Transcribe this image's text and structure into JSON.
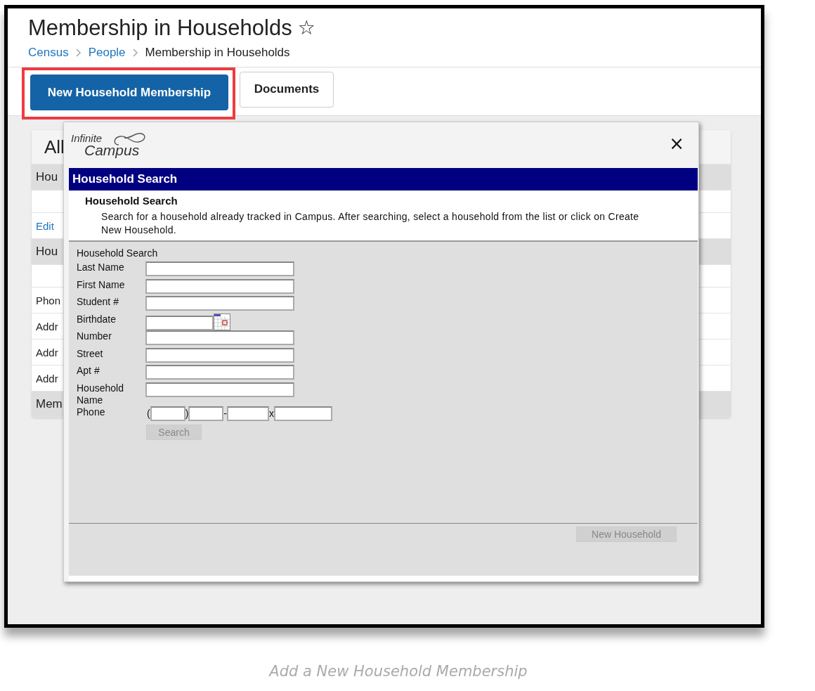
{
  "page": {
    "title": "Membership in Households",
    "favorite_icon": "☆",
    "breadcrumbs": [
      {
        "label": "Census",
        "link": true
      },
      {
        "label": "People",
        "link": true
      },
      {
        "label": "Membership in Households",
        "link": false
      }
    ]
  },
  "toolbar": {
    "buttons": [
      {
        "label": "New Household Membership",
        "kind": "primary",
        "highlighted": true
      },
      {
        "label": "Documents",
        "kind": "secondary",
        "highlighted": false
      }
    ]
  },
  "background_card": {
    "rows": [
      {
        "kind": "title",
        "text": "All"
      },
      {
        "kind": "header",
        "text": "Hou"
      },
      {
        "kind": "blank"
      },
      {
        "kind": "link",
        "text": "Edit"
      },
      {
        "kind": "header",
        "text": "Hou"
      },
      {
        "kind": "blank"
      },
      {
        "kind": "text",
        "text": "Phon"
      },
      {
        "kind": "text",
        "text": "Addr"
      },
      {
        "kind": "text",
        "text": "Addr"
      },
      {
        "kind": "text",
        "text": "Addr"
      },
      {
        "kind": "header",
        "text": "Mem"
      }
    ]
  },
  "modal": {
    "logo": {
      "top": "Infinite",
      "bottom": "Campus"
    },
    "close": "×",
    "title": "Household Search",
    "intro": {
      "title": "Household Search",
      "description": "Search for a household already tracked in Campus. After searching, select a household from the list or click on Create New Household."
    },
    "form": {
      "heading": "Household Search",
      "fields": [
        {
          "label": "Last Name",
          "kind": "text"
        },
        {
          "label": "First Name",
          "kind": "text"
        },
        {
          "label": "Student #",
          "kind": "text"
        },
        {
          "label": "Birthdate",
          "kind": "date"
        },
        {
          "label": "Number",
          "kind": "text"
        },
        {
          "label": "Street",
          "kind": "text"
        },
        {
          "label": "Apt #",
          "kind": "text"
        },
        {
          "label": "Household Name",
          "kind": "text"
        },
        {
          "label": "Phone",
          "kind": "phone",
          "separators": [
            "(",
            ")",
            "-",
            "x"
          ]
        }
      ],
      "search_button": {
        "label": "Search",
        "disabled": true
      }
    },
    "footer_button": {
      "label": "New Household",
      "disabled": true
    }
  },
  "caption": "Add a New Household Membership"
}
